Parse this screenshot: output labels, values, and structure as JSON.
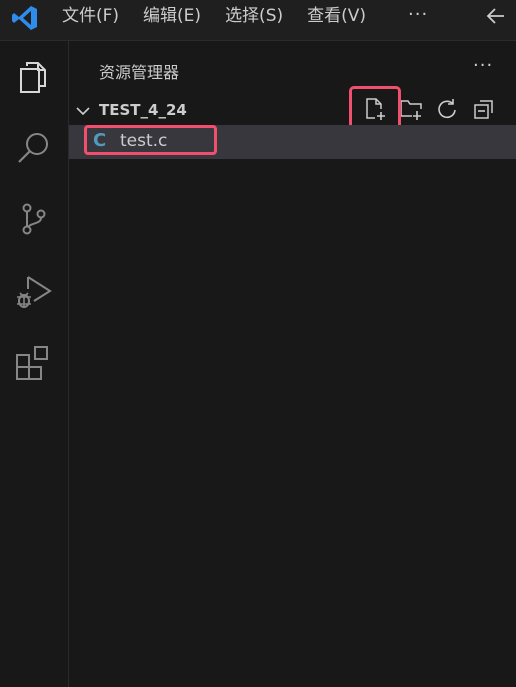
{
  "titlebar": {
    "menus": [
      "文件(F)",
      "编辑(E)",
      "选择(S)",
      "查看(V)"
    ],
    "more": "···"
  },
  "explorer": {
    "title": "资源管理器",
    "more": "···",
    "folder": "TEST_4_24",
    "files": [
      {
        "icon_letter": "C",
        "name": "test.c"
      }
    ]
  },
  "activity_icons": [
    "explorer-icon",
    "search-icon",
    "source-control-icon",
    "run-debug-icon",
    "extensions-icon"
  ],
  "toolbar_icons": [
    "new-file-icon",
    "new-folder-icon",
    "refresh-icon",
    "collapse-all-icon"
  ],
  "colors": {
    "background": "#181818",
    "selection": "#37373d",
    "highlight": "#f0506e",
    "c_icon": "#519aba",
    "vscode_blue": "#2f8ceb"
  }
}
